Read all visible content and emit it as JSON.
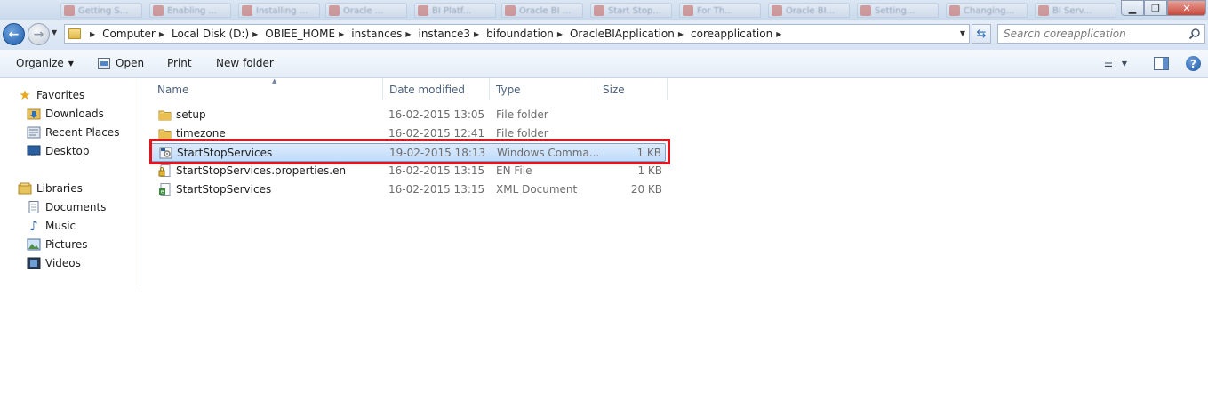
{
  "window": {
    "ghost_tabs": [
      "Getting S...",
      "Enabling ...",
      "Installing ...",
      "Oracle ...",
      "BI Platf...",
      "Oracle BI ...",
      "Start Stop...",
      "For Th...",
      "Oracle BI...",
      "Setting...",
      "Changing...",
      "BI Serv..."
    ],
    "min_label": "▁",
    "max_label": "❐",
    "close_label": "✕"
  },
  "address": {
    "crumbs": [
      "Computer",
      "Local Disk (D:)",
      "OBIEE_HOME",
      "instances",
      "instance3",
      "bifoundation",
      "OracleBIApplication",
      "coreapplication"
    ],
    "search_placeholder": "Search coreapplication"
  },
  "commands": {
    "organize": "Organize",
    "open": "Open",
    "print": "Print",
    "new_folder": "New folder"
  },
  "nav": {
    "favorites_label": "Favorites",
    "favorites": [
      "Downloads",
      "Recent Places",
      "Desktop"
    ],
    "libraries_label": "Libraries",
    "libraries": [
      "Documents",
      "Music",
      "Pictures",
      "Videos"
    ]
  },
  "columns": {
    "name": "Name",
    "date": "Date modified",
    "type": "Type",
    "size": "Size"
  },
  "files": [
    {
      "name": "setup",
      "date": "16-02-2015 13:05",
      "type": "File folder",
      "size": "",
      "icon": "folder-icon"
    },
    {
      "name": "timezone",
      "date": "16-02-2015 12:41",
      "type": "File folder",
      "size": "",
      "icon": "folder-icon"
    },
    {
      "name": "StartStopServices",
      "date": "19-02-2015 18:13",
      "type": "Windows Comma...",
      "size": "1 KB",
      "icon": "batch-file-icon"
    },
    {
      "name": "StartStopServices.properties.en",
      "date": "16-02-2015 13:15",
      "type": "EN File",
      "size": "1 KB",
      "icon": "locked-file-icon"
    },
    {
      "name": "StartStopServices",
      "date": "16-02-2015 13:15",
      "type": "XML Document",
      "size": "20 KB",
      "icon": "xml-file-icon"
    }
  ],
  "colors": {
    "highlight": "#e2151e",
    "selection": "#c1dcfc",
    "accent": "#1f5ca8"
  }
}
